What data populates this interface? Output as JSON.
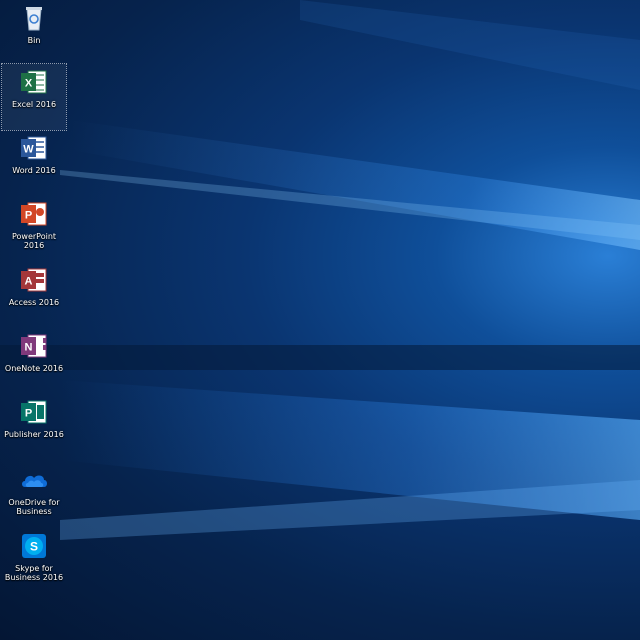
{
  "desktop": {
    "icons": [
      {
        "name": "recycle-bin",
        "label": "Bin"
      },
      {
        "name": "excel-2016",
        "label": "Excel 2016",
        "letter": "X",
        "color": "#1e7145"
      },
      {
        "name": "word-2016",
        "label": "Word 2016",
        "letter": "W",
        "color": "#2b579a"
      },
      {
        "name": "powerpoint-2016",
        "label": "PowerPoint 2016",
        "letter": "P",
        "color": "#d24726"
      },
      {
        "name": "access-2016",
        "label": "Access 2016",
        "letter": "A",
        "color": "#a4373a"
      },
      {
        "name": "onenote-2016",
        "label": "OneNote 2016",
        "letter": "N",
        "color": "#80397b"
      },
      {
        "name": "publisher-2016",
        "label": "Publisher 2016",
        "letter": "P",
        "color": "#077568"
      },
      {
        "name": "onedrive-business",
        "label": "OneDrive for Business"
      },
      {
        "name": "skype-business",
        "label": "Skype for Business 2016",
        "letter": "S",
        "color": "#00aff0"
      }
    ]
  }
}
